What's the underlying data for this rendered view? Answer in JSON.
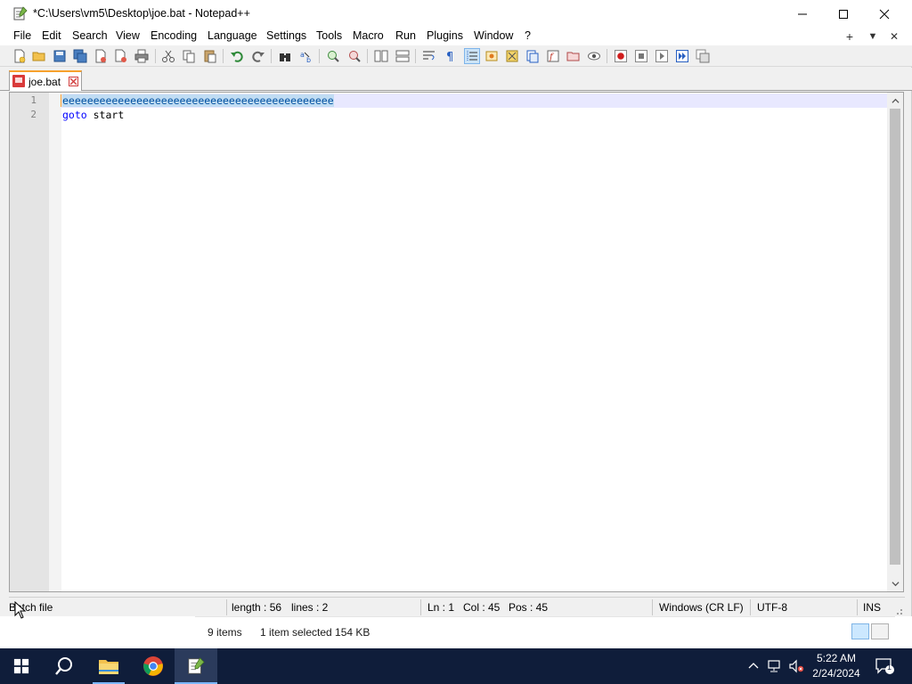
{
  "window": {
    "title": "*C:\\Users\\vm5\\Desktop\\joe.bat - Notepad++"
  },
  "menu": {
    "items": [
      "File",
      "Edit",
      "Search",
      "View",
      "Encoding",
      "Language",
      "Settings",
      "Tools",
      "Macro",
      "Run",
      "Plugins",
      "Window",
      "?"
    ],
    "right_plus": "+",
    "right_down": "▼",
    "right_close": "✕"
  },
  "tabs": [
    {
      "label": "joe.bat",
      "modified": true
    }
  ],
  "editor": {
    "line_numbers": [
      "1",
      "2"
    ],
    "lines": [
      {
        "selected_text": "eeeeeeeeeeeeeeeeeeeeeeeeeeeeeeeeeeeeeeeeeeee"
      },
      {
        "keyword": "goto",
        "rest": " start"
      }
    ]
  },
  "status": {
    "file_type": "Batch file",
    "length": "length : 56",
    "lines": "lines : 2",
    "ln": "Ln : 1",
    "col": "Col : 45",
    "pos": "Pos : 45",
    "eol": "Windows (CR LF)",
    "encoding": "UTF-8",
    "mode": "INS"
  },
  "explorer": {
    "items_count": "9 items",
    "selection": "1 item selected  154 KB"
  },
  "taskbar": {
    "time": "5:22 AM",
    "date": "2/24/2024",
    "notification_count": "1"
  },
  "colors": {
    "taskbar_bg": "#0f1d3a",
    "tab_accent": "#f7a12c",
    "selection": "#c0dcf3",
    "keyword": "#0000ff"
  }
}
